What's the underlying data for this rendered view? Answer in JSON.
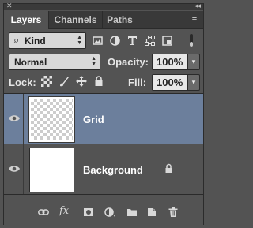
{
  "tabs": [
    {
      "label": "Layers"
    },
    {
      "label": "Channels"
    },
    {
      "label": "Paths"
    }
  ],
  "filter": {
    "label": "Kind",
    "icon": "search-icon"
  },
  "filter_icons": [
    "image-icon",
    "adjustment-icon",
    "type-icon",
    "shape-icon",
    "smart-object-icon"
  ],
  "blend_mode": "Normal",
  "opacity": {
    "label": "Opacity:",
    "value": "100%"
  },
  "lock": {
    "label": "Lock:",
    "icons": [
      "lock-transparent-icon",
      "lock-image-icon",
      "lock-position-icon",
      "lock-all-icon"
    ]
  },
  "fill": {
    "label": "Fill:",
    "value": "100%"
  },
  "layers": [
    {
      "name": "Grid",
      "selected": true,
      "visible": true,
      "thumbnail": "transparent"
    },
    {
      "name": "Background",
      "selected": false,
      "visible": true,
      "thumbnail": "white",
      "locked": true
    }
  ],
  "bottom_icons": [
    "link-icon",
    "fx-icon",
    "mask-icon",
    "adjustment-layer-icon",
    "group-folder-icon",
    "new-layer-icon",
    "trash-icon"
  ],
  "bottom_fx": "fx",
  "colors": {
    "panel": "#535353",
    "selected_layer": "#6c7f9c",
    "tab_bar": "#393939"
  }
}
